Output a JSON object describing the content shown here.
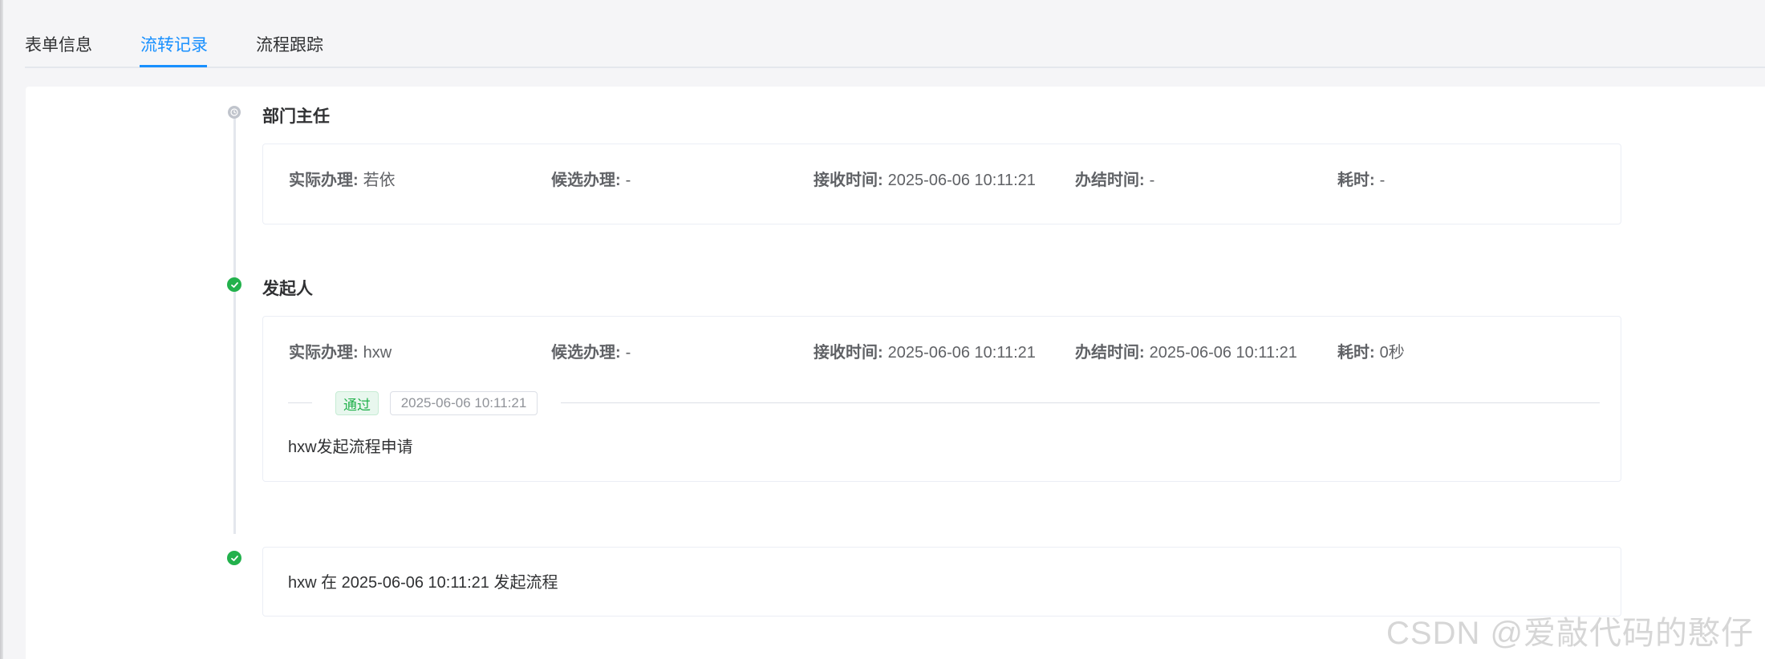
{
  "tabs": [
    {
      "label": "表单信息",
      "active": false
    },
    {
      "label": "流转记录",
      "active": true
    },
    {
      "label": "流程跟踪",
      "active": false
    }
  ],
  "colors": {
    "accent": "#1890ff",
    "success": "#22b14c",
    "pending": "#c0c4cc"
  },
  "timeline": {
    "node1": {
      "title": "部门主任",
      "status_icon": "clock-icon",
      "fields": [
        {
          "label": "实际办理:",
          "value": "若依"
        },
        {
          "label": "候选办理:",
          "value": "-"
        },
        {
          "label": "接收时间:",
          "value": "2025-06-06 10:11:21"
        },
        {
          "label": "办结时间:",
          "value": "-"
        },
        {
          "label": "耗时:",
          "value": "-"
        }
      ]
    },
    "node2": {
      "title": "发起人",
      "status_icon": "check-circle-icon",
      "fields": [
        {
          "label": "实际办理:",
          "value": "hxw"
        },
        {
          "label": "候选办理:",
          "value": "-"
        },
        {
          "label": "接收时间:",
          "value": "2025-06-06 10:11:21"
        },
        {
          "label": "办结时间:",
          "value": "2025-06-06 10:11:21"
        },
        {
          "label": "耗时:",
          "value": "0秒"
        }
      ],
      "result_tag": "通过",
      "result_time": "2025-06-06 10:11:21",
      "comment": "hxw发起流程申请"
    },
    "node3": {
      "status_icon": "check-circle-icon",
      "text": "hxw 在 2025-06-06 10:11:21 发起流程"
    }
  },
  "watermark": "CSDN @爱敲代码的憨仔"
}
